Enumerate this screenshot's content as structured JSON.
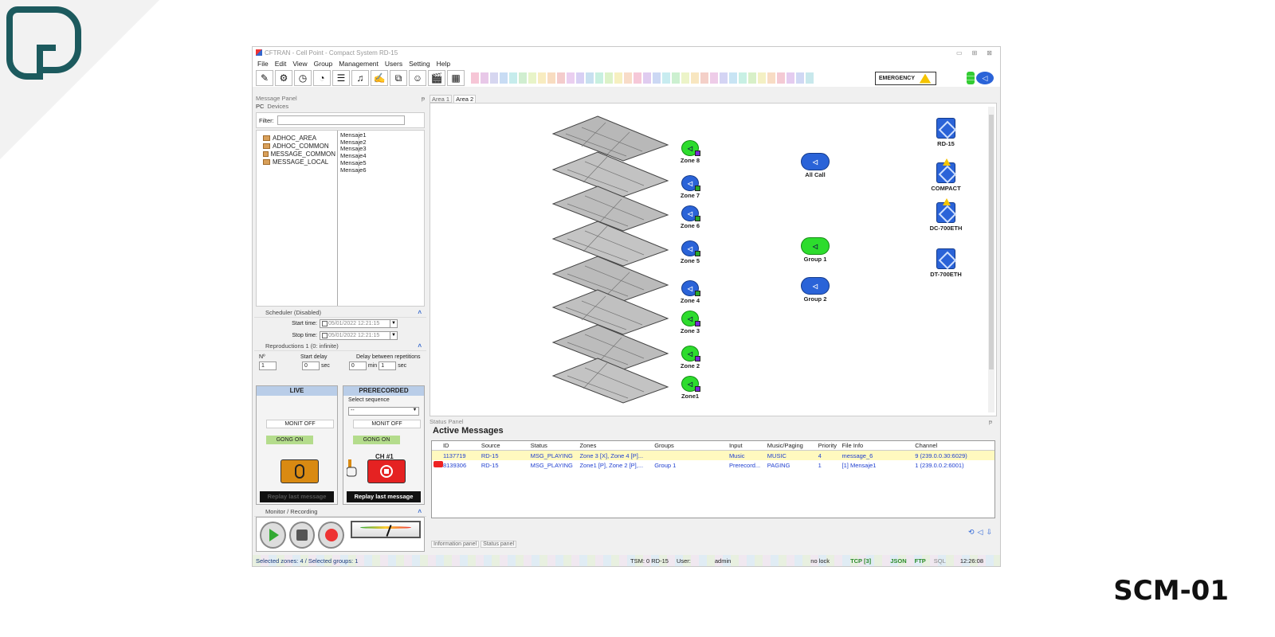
{
  "brand": {
    "code": "SCM-01"
  },
  "window": {
    "title": "CFTRAN - Cell Point - Compact System RD-15",
    "controls": [
      "▭",
      "⊞",
      "⊠"
    ]
  },
  "menu": [
    "File",
    "Edit",
    "View",
    "Group",
    "Management",
    "Users",
    "Setting",
    "Help"
  ],
  "toolbar": {
    "icons": [
      "pencil-icon",
      "speakers-icon",
      "clock-speaker-icon",
      "clock-check-icon",
      "list-icon",
      "music-list-icon",
      "edit-note-icon",
      "zones-edit-icon",
      "users-icon",
      "clapper-icon",
      "schedule-icon"
    ],
    "icon_glyphs": [
      "✎",
      "⚙",
      "◷",
      "◔",
      "☰",
      "♫",
      "✍",
      "⧉",
      "☺",
      "🎬",
      "▦"
    ],
    "emergency_label": "EMERGENCY"
  },
  "message_panel": {
    "title": "Message Panel",
    "pin": "ᵽ",
    "tabs": [
      "PC",
      "Devices"
    ],
    "filter_label": "Filter:",
    "filter_value": "",
    "folders": [
      "ADHOC_AREA",
      "ADHOC_COMMON",
      "MESSAGE_COMMON",
      "MESSAGE_LOCAL"
    ],
    "messages": [
      "Mensaje1",
      "Mensaje2",
      "Mensaje3",
      "Mensaje4",
      "Mensaje5",
      "Mensaje6"
    ]
  },
  "scheduler": {
    "title": "Scheduler (Disabled)",
    "start_label": "Start time:",
    "start_value": "05/01/2022 12:21:15",
    "stop_label": "Stop time:",
    "stop_value": "05/01/2022 12:21:15"
  },
  "reproductions": {
    "title": "Reproductions 1 (0: infinite)",
    "n_label": "Nº",
    "start_delay_label": "Start delay",
    "delay_between_label": "Delay between repetitions",
    "n_value": "1",
    "start_delay_value": "0",
    "sec_unit": "sec",
    "min_value": "0",
    "min_unit": "min",
    "sec_value": "1"
  },
  "live": {
    "title": "LIVE",
    "monit": "MONIT OFF",
    "gong": "GONG ON",
    "replay": "Replay last message"
  },
  "prerecorded": {
    "title": "PRERECORDED",
    "select_label": "Select sequence",
    "select_value": "--",
    "monit": "MONIT OFF",
    "gong": "GONG ON",
    "channel": "CH #1",
    "replay": "Replay last message"
  },
  "monitor": {
    "title": "Monitor / Recording"
  },
  "map": {
    "tabs": [
      "Area 1",
      "Area 2"
    ],
    "active_tab": "Area 2",
    "zones": [
      "Zone 8",
      "Zone 7",
      "Zone 6",
      "Zone 5",
      "Zone 4",
      "Zone 3",
      "Zone 2",
      "Zone1"
    ],
    "all_call": "All Call",
    "groups": [
      "Group 1",
      "Group 2"
    ],
    "devices": [
      "RD-15",
      "COMPACT",
      "DC-700ETH",
      "DT-700ETH"
    ]
  },
  "status_panel": {
    "title": "Status Panel",
    "heading": "Active Messages",
    "columns": [
      "ID",
      "Source",
      "Status",
      "Zones",
      "Groups",
      "Input",
      "Music/Paging",
      "Priority",
      "File Info",
      "Channel"
    ],
    "rows": [
      [
        "1137719",
        "RD-15",
        "MSG_PLAYING",
        "Zone 3 [X], Zone 4 [P]...",
        "",
        "Music",
        "MUSIC",
        "4",
        "message_6",
        "9 (239.0.0.30:6029)"
      ],
      [
        "8139306",
        "RD-15",
        "MSG_PLAYING",
        "Zone1 [P], Zone 2 [P],...",
        "Group 1",
        "Prerecord...",
        "PAGING",
        "1",
        "[1] Mensaje1",
        "1 (239.0.0.2:6001)"
      ]
    ],
    "bottom_tabs": [
      "Information panel",
      "Status panel"
    ]
  },
  "statusbar": {
    "selection": "Selected zones: 4 / Selected groups: 1",
    "tsm": "TSM: 0 RD-15",
    "user_label": "User:",
    "user": "admin",
    "lock": "no lock",
    "tcp": "TCP [3]",
    "json": "JSON",
    "ftp": "FTP",
    "sql": "SQL",
    "time": "12:26:08"
  }
}
